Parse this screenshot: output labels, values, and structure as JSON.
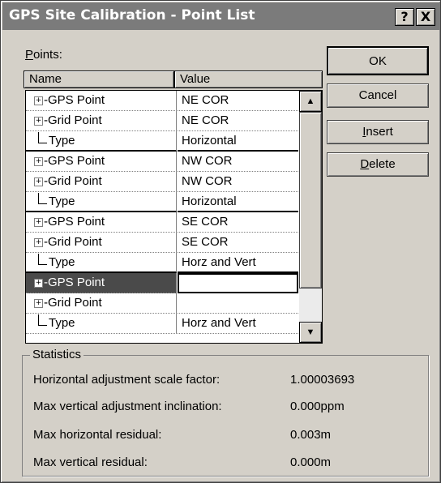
{
  "window": {
    "title": "GPS Site Calibration - Point List",
    "help_label": "?",
    "close_label": "X"
  },
  "points": {
    "label": "Points:",
    "columns": [
      "Name",
      "Value"
    ],
    "rows": [
      {
        "name": "GPS Point",
        "value": "NE COR",
        "kind": "gps"
      },
      {
        "name": "Grid Point",
        "value": "NE COR",
        "kind": "grid"
      },
      {
        "name": "Type",
        "value": "Horizontal",
        "kind": "type"
      },
      {
        "name": "GPS Point",
        "value": "NW COR",
        "kind": "gps"
      },
      {
        "name": "Grid Point",
        "value": "NW COR",
        "kind": "grid"
      },
      {
        "name": "Type",
        "value": "Horizontal",
        "kind": "type"
      },
      {
        "name": "GPS Point",
        "value": "SE COR",
        "kind": "gps"
      },
      {
        "name": "Grid Point",
        "value": "SE COR",
        "kind": "grid"
      },
      {
        "name": "Type",
        "value": "Horz and Vert",
        "kind": "type"
      },
      {
        "name": "GPS Point",
        "value": "",
        "kind": "gps",
        "selected": true
      },
      {
        "name": "Grid Point",
        "value": "",
        "kind": "grid"
      },
      {
        "name": "Type",
        "value": "Horz and Vert",
        "kind": "type"
      }
    ]
  },
  "buttons": {
    "ok": "OK",
    "cancel": "Cancel",
    "insert": "Insert",
    "delete": "Delete"
  },
  "statistics": {
    "title": "Statistics",
    "items": [
      {
        "label": "Horizontal adjustment scale factor:",
        "value": "1.00003693"
      },
      {
        "label": "Max vertical adjustment inclination:",
        "value": "0.000ppm"
      },
      {
        "label": "Max horizontal residual:",
        "value": "0.003m"
      },
      {
        "label": "Max vertical residual:",
        "value": "0.000m"
      }
    ]
  },
  "icons": {
    "expand": "plus-box-icon",
    "scroll_up": "arrow-up-icon",
    "scroll_down": "arrow-down-icon"
  }
}
